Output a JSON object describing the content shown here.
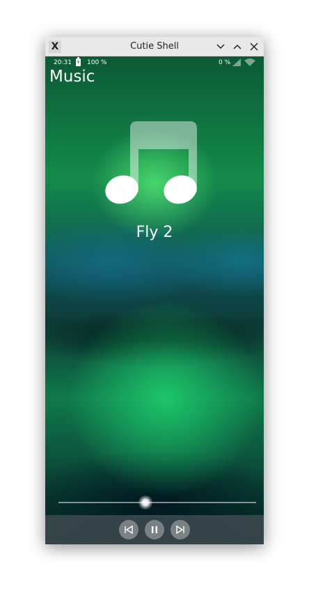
{
  "window": {
    "title": "Cutie Shell",
    "app_icon_glyph": "X"
  },
  "statusbar": {
    "time": "20:31",
    "battery": "100 %",
    "signal_percent": "0 %"
  },
  "app": {
    "title": "Music"
  },
  "player": {
    "track_title": "Fly 2",
    "progress": 0.44,
    "icons": {
      "artwork": "music-note-icon",
      "previous": "skip-previous-icon",
      "pause": "pause-icon",
      "next": "skip-next-icon"
    }
  },
  "colors": {
    "accent_green": "#1fd06a",
    "titlebar_bg": "#e8e8e8"
  }
}
